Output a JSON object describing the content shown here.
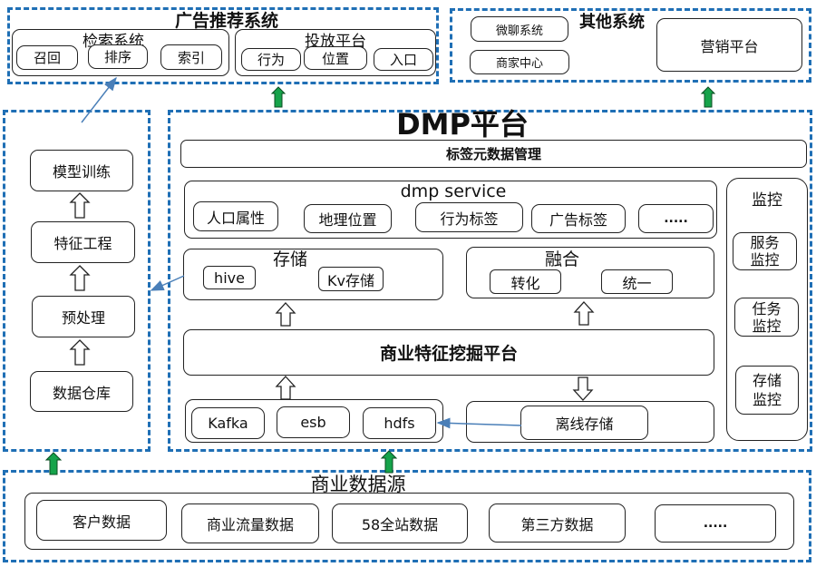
{
  "ad_system": {
    "title": "广告推荐系统",
    "retrieval": {
      "title": "检索系统",
      "items": [
        "召回",
        "排序",
        "索引"
      ]
    },
    "delivery": {
      "title": "投放平台",
      "items": [
        "行为",
        "位置",
        "入口"
      ]
    }
  },
  "other_systems": {
    "title": "其他系统",
    "items": [
      "微聊系统",
      "商家中心"
    ],
    "marketing": "营销平台"
  },
  "ml_pipeline": {
    "steps": [
      "模型训练",
      "特征工程",
      "预处理",
      "数据仓库"
    ]
  },
  "dmp": {
    "title": "DMP平台",
    "tag_meta": "标签元数据管理",
    "service": {
      "title": "dmp service",
      "items": [
        "人口属性",
        "地理位置",
        "行为标签",
        "广告标签",
        "....."
      ]
    },
    "storage": {
      "title": "存储",
      "items": [
        "hive",
        "Kv存储"
      ]
    },
    "fusion": {
      "title": "融合",
      "items": [
        "转化",
        "统一"
      ]
    },
    "mining": "商业特征挖掘平台",
    "ingest": [
      "Kafka",
      "esb",
      "hdfs"
    ],
    "offline": "离线存储",
    "monitor": {
      "title": "监控",
      "items": [
        "服务\n监控",
        "任务\n监控",
        "存储\n监控"
      ],
      "items_lines": [
        [
          "服务",
          "监控"
        ],
        [
          "任务",
          "监控"
        ],
        [
          "存储",
          "监控"
        ]
      ]
    }
  },
  "data_source": {
    "title": "商业数据源",
    "items": [
      "客户数据",
      "商业流量数据",
      "58全站数据",
      "第三方数据",
      "....."
    ]
  },
  "colors": {
    "dashed_border": "#1f6fb5",
    "green_arrow": "#16a34a",
    "blue_arrow": "#4a7fb8"
  }
}
